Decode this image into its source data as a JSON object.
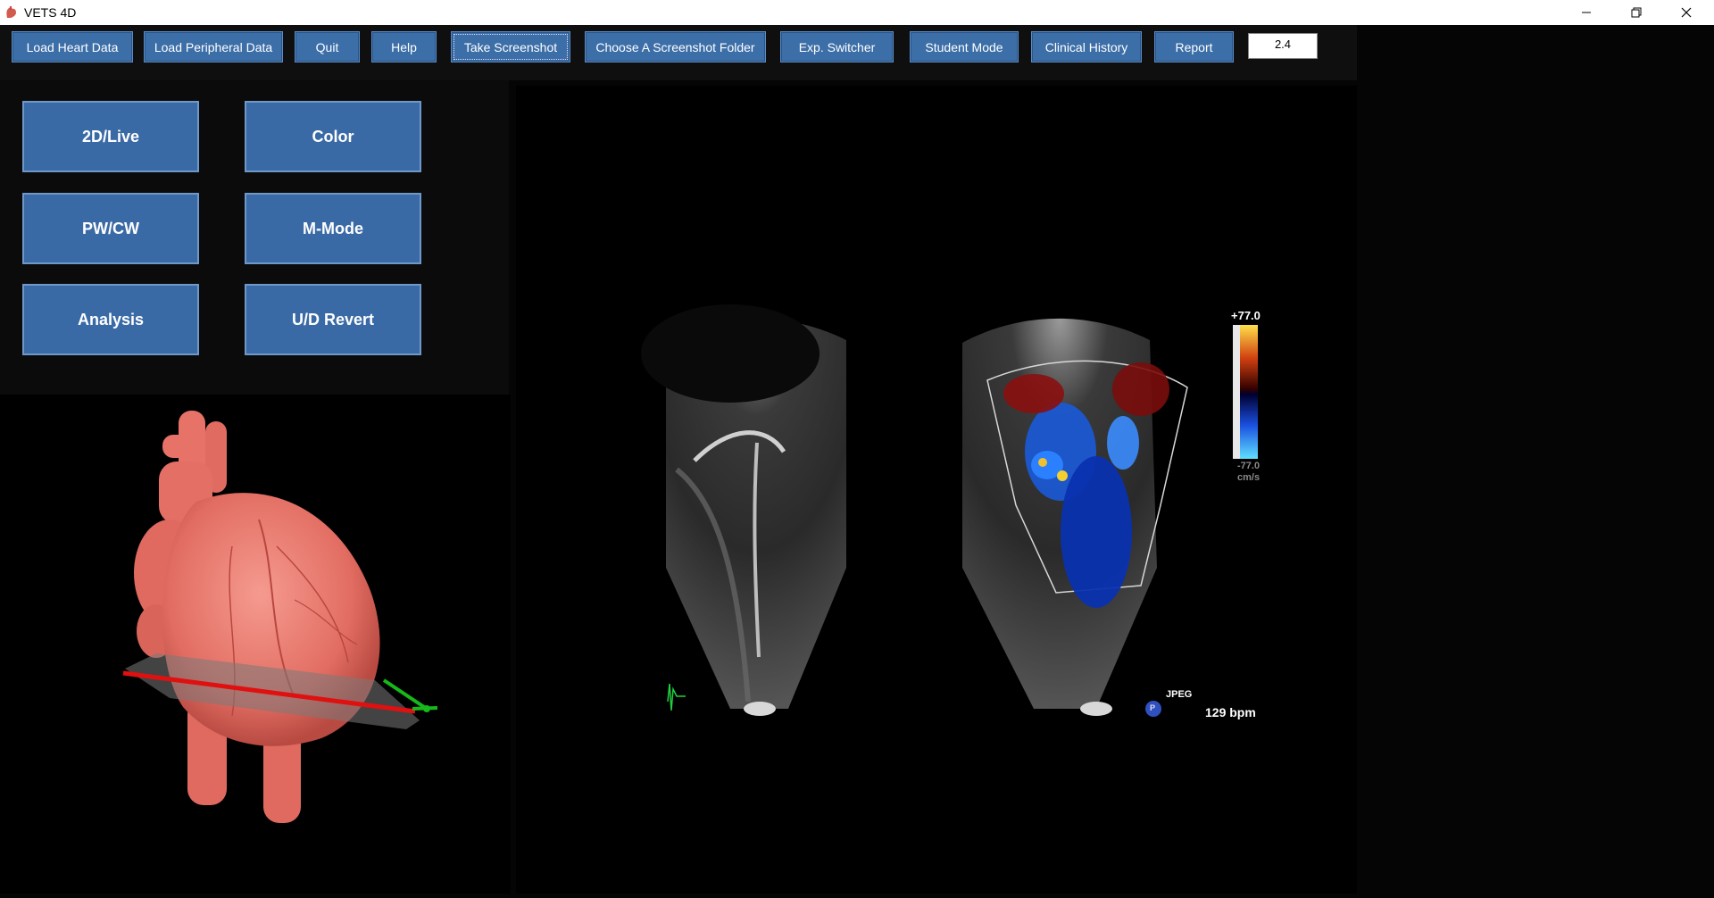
{
  "window": {
    "title": "VETS 4D"
  },
  "toolbar": {
    "buttons": [
      {
        "label": "Load Heart Data"
      },
      {
        "label": "Load Peripheral Data"
      },
      {
        "label": "Quit"
      },
      {
        "label": "Help"
      },
      {
        "label": "Take Screenshot"
      },
      {
        "label": "Choose A Screenshot Folder"
      },
      {
        "label": "Exp. Switcher"
      },
      {
        "label": "Student Mode"
      },
      {
        "label": "Clinical History"
      },
      {
        "label": "Report"
      }
    ],
    "zoom_value": "2.4"
  },
  "modes": {
    "buttons": [
      {
        "label": "2D/Live"
      },
      {
        "label": "Color"
      },
      {
        "label": "PW/CW"
      },
      {
        "label": "M-Mode"
      },
      {
        "label": "Analysis"
      },
      {
        "label": "U/D Revert"
      }
    ]
  },
  "ultrasound": {
    "scale_top": "+77.0",
    "scale_bottom": "-77.0",
    "scale_unit": "cm/s",
    "format": "JPEG",
    "probe_badge": "P",
    "heart_rate": "129 bpm"
  },
  "colors": {
    "button_blue": "#3c6ea8",
    "heart_red": "#e8736a",
    "axis_red": "#e01010",
    "axis_green": "#16b81a"
  }
}
